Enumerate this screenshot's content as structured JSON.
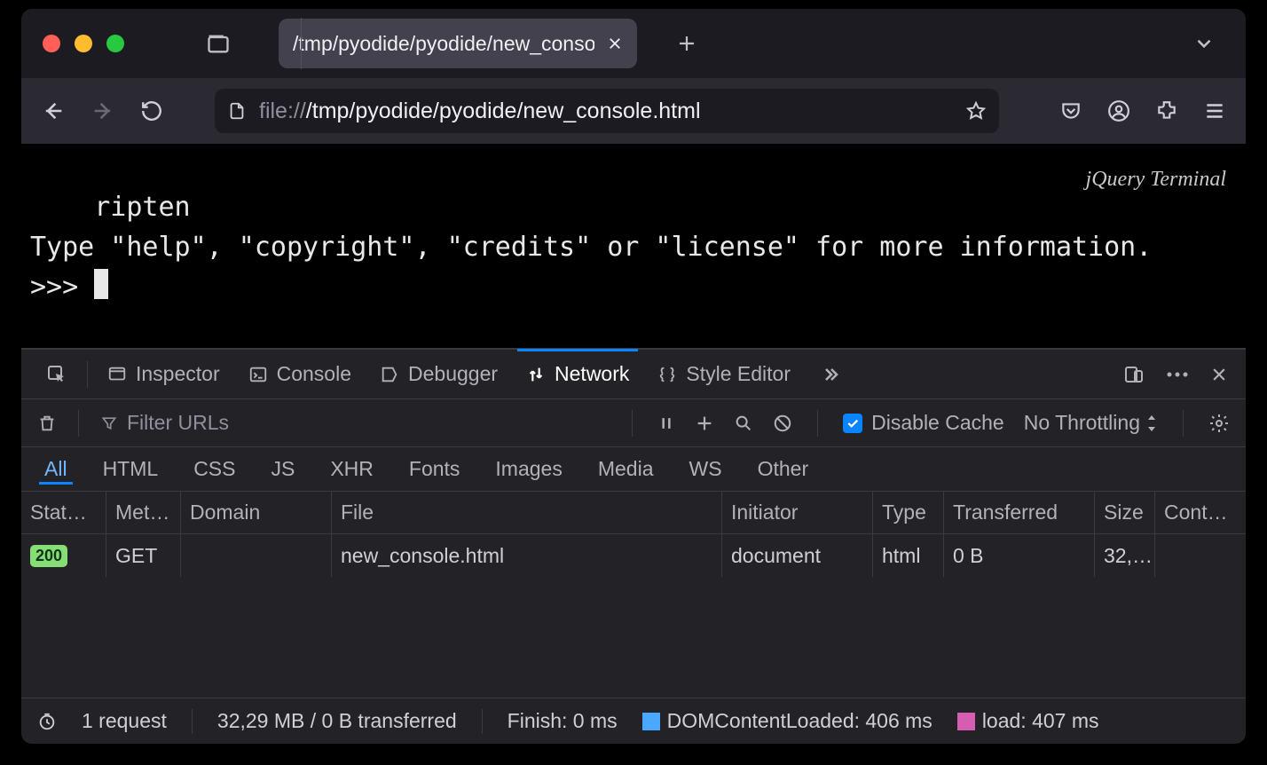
{
  "tab": {
    "title": "/tmp/pyodide/pyodide/new_console."
  },
  "url": {
    "scheme": "file://",
    "path": "/tmp/pyodide/pyodide/new_console.html"
  },
  "terminal": {
    "watermark": "jQuery Terminal",
    "line1": "ripten",
    "line2": "Type \"help\", \"copyright\", \"credits\" or \"license\" for more information.",
    "prompt": ">>> "
  },
  "devtools": {
    "tabs": {
      "inspector": "Inspector",
      "console": "Console",
      "debugger": "Debugger",
      "network": "Network",
      "style_editor": "Style Editor"
    },
    "toolbar": {
      "filter_placeholder": "Filter URLs",
      "disable_cache": "Disable Cache",
      "throttling": "No Throttling"
    },
    "filters": [
      "All",
      "HTML",
      "CSS",
      "JS",
      "XHR",
      "Fonts",
      "Images",
      "Media",
      "WS",
      "Other"
    ],
    "columns": [
      "Stat…",
      "Met…",
      "Domain",
      "File",
      "Initiator",
      "Type",
      "Transferred",
      "Size",
      "Cont…"
    ],
    "row": {
      "status": "200",
      "method": "GET",
      "domain": "",
      "file": "new_console.html",
      "initiator": "document",
      "type": "html",
      "transferred": "0 B",
      "size": "32,…",
      "content": ""
    },
    "footer": {
      "requests": "1 request",
      "transferred": "32,29 MB / 0 B transferred",
      "finish": "Finish: 0 ms",
      "dcl": "DOMContentLoaded: 406 ms",
      "load": "load: 407 ms"
    }
  }
}
